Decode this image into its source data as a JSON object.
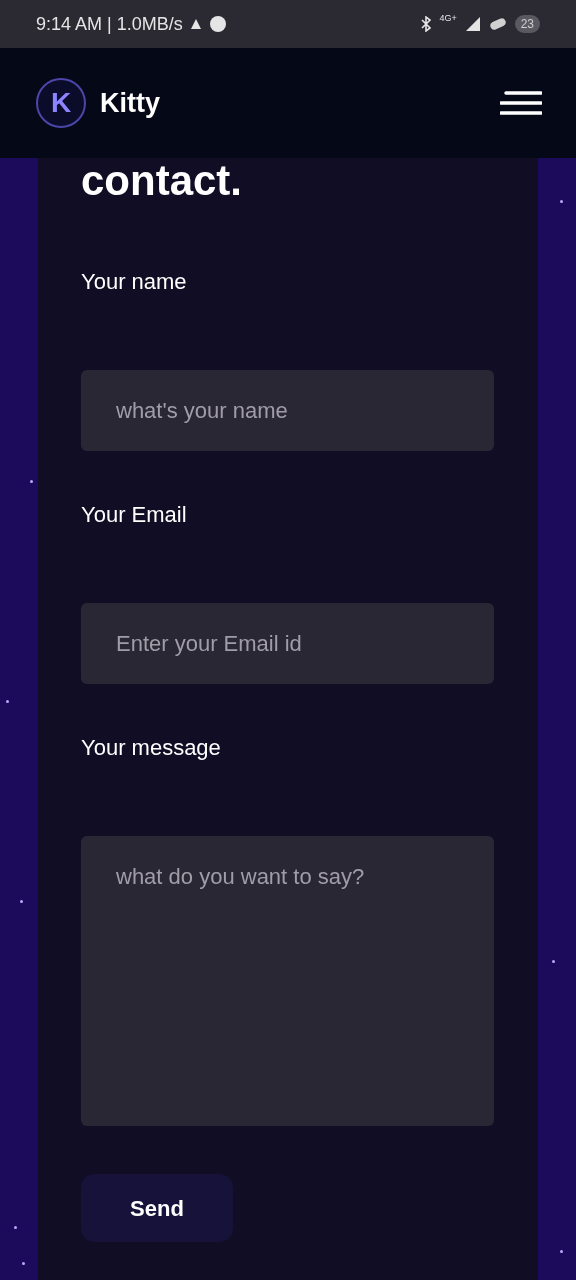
{
  "status_bar": {
    "time": "9:14 AM | 1.0MB/s",
    "network": "4G+",
    "battery": "23"
  },
  "header": {
    "brand": "Kitty",
    "logo_letter": "K"
  },
  "contact": {
    "heading": "contact.",
    "fields": [
      {
        "label": "Your name",
        "placeholder": "what's your name",
        "kind": "input"
      },
      {
        "label": "Your Email",
        "placeholder": "Enter your Email id",
        "kind": "input"
      },
      {
        "label": "Your message",
        "placeholder": "what do you want to say?",
        "kind": "textarea"
      }
    ],
    "submit": "Send"
  }
}
